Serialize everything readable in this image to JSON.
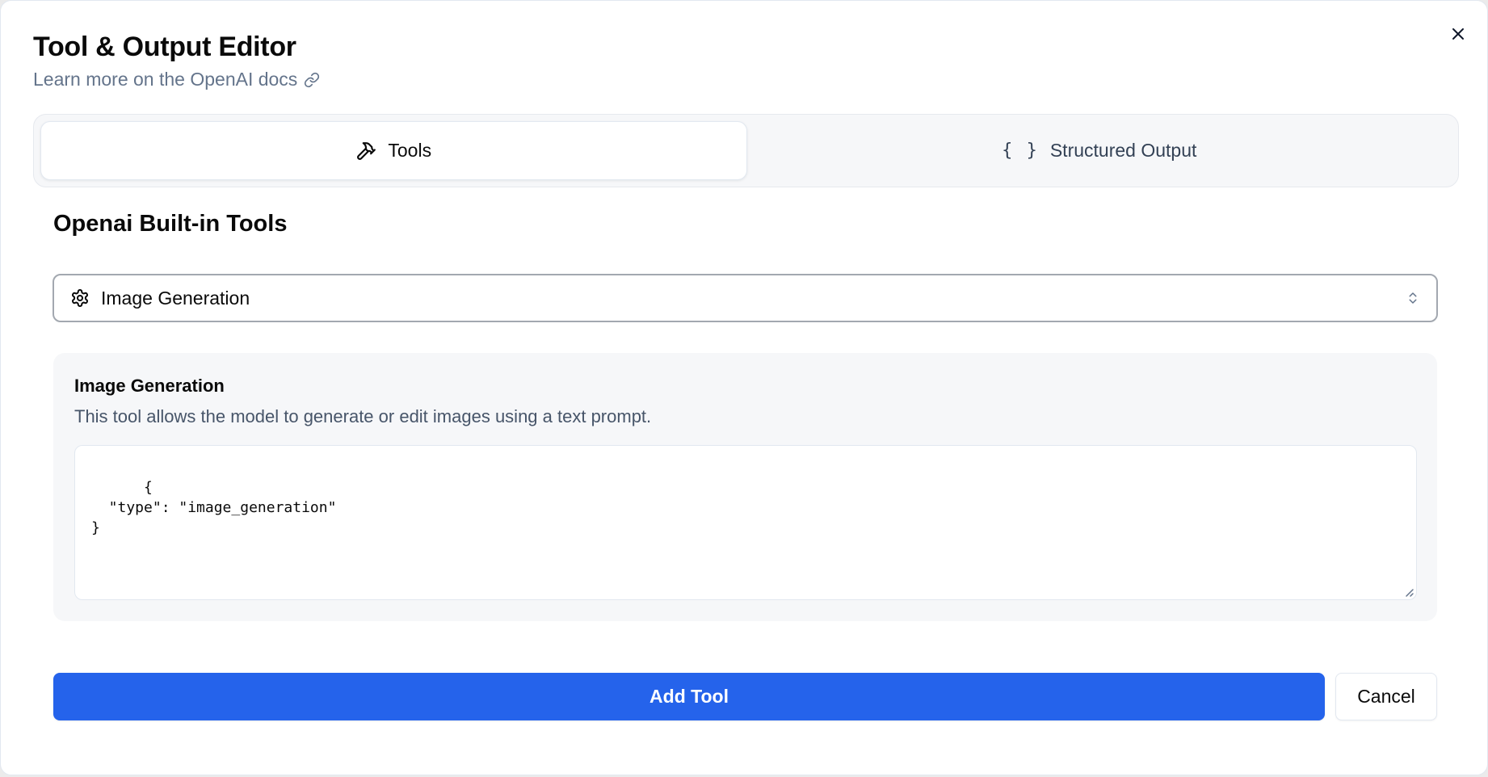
{
  "dialog": {
    "title": "Tool & Output Editor",
    "subtitle": "Learn more on the OpenAI docs",
    "subtitle_icon": "link-icon",
    "close_icon": "close-icon"
  },
  "tabs": [
    {
      "label": "Tools",
      "icon": "hammer-icon",
      "active": true
    },
    {
      "label": "Structured Output",
      "icon": "braces-icon",
      "glyph": "{ }",
      "active": false
    }
  ],
  "section": {
    "heading": "Openai Built-in Tools"
  },
  "select": {
    "icon": "gear-icon",
    "value": "Image Generation",
    "chevron_icon": "chevrons-up-down-icon"
  },
  "tool_detail": {
    "title": "Image Generation",
    "description": "This tool allows the model to generate or edit images using a text prompt.",
    "code": "{\n  \"type\": \"image_generation\"\n}"
  },
  "actions": {
    "primary_label": "Add Tool",
    "secondary_label": "Cancel"
  },
  "colors": {
    "primary": "#2563eb",
    "muted_text": "#64748b",
    "panel_bg": "#f6f7f9"
  }
}
